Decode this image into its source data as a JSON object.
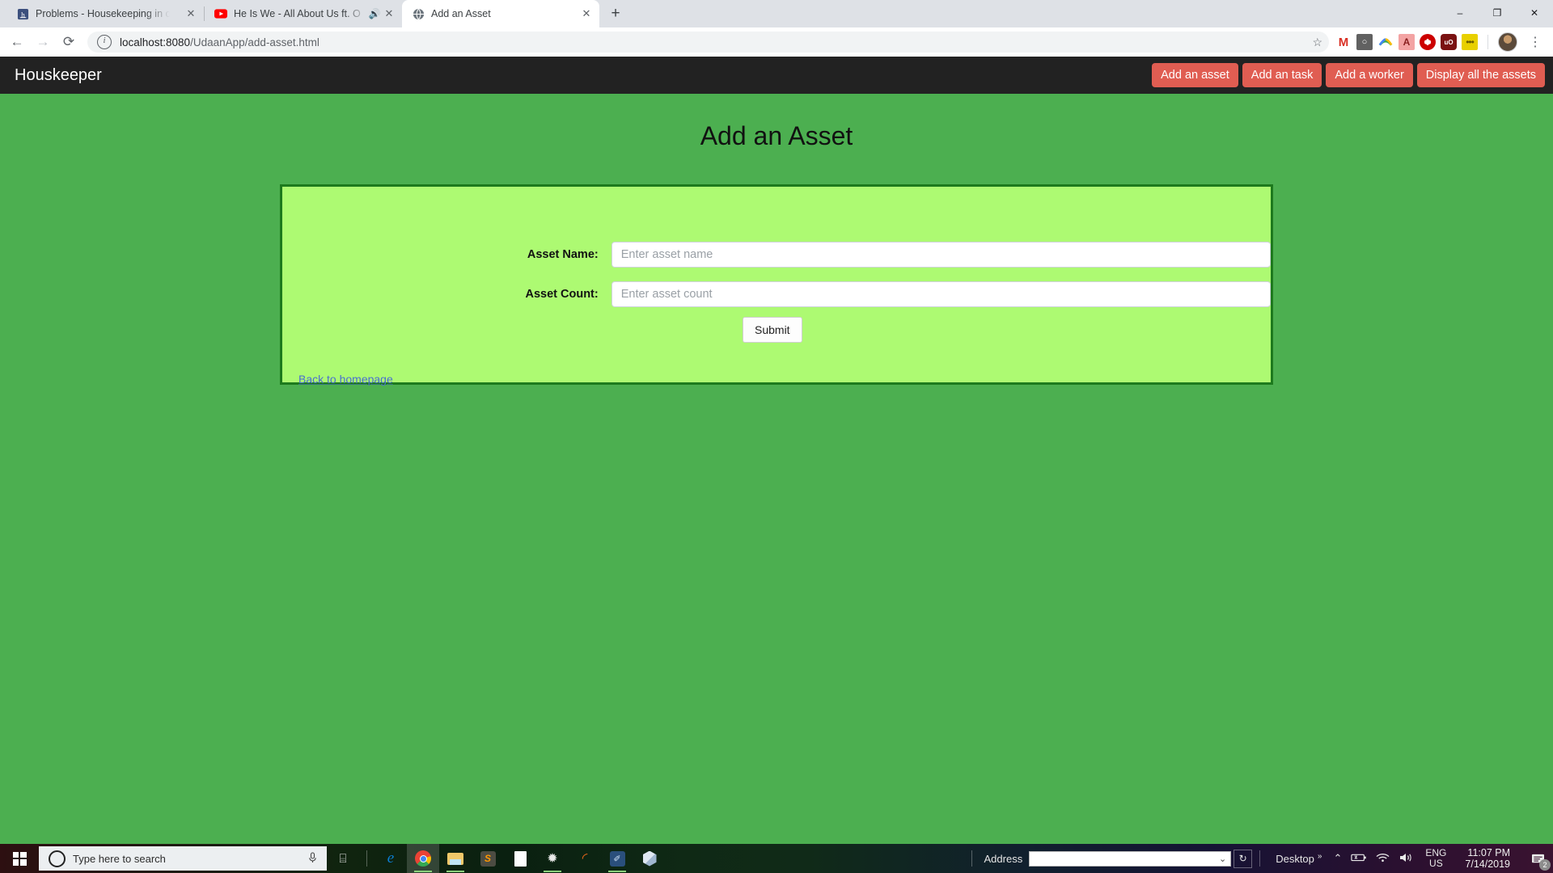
{
  "browser": {
    "tabs": [
      {
        "title": "Problems - Housekeeping in orde",
        "favicon": "hackerearth-icon",
        "audio": "",
        "close": "✕",
        "active": false
      },
      {
        "title": "He Is We - All About Us ft. O",
        "favicon": "youtube-icon",
        "audio": "🔊",
        "close": "✕",
        "active": false
      },
      {
        "title": "Add an Asset",
        "favicon": "globe-icon",
        "audio": "",
        "close": "✕",
        "active": true
      }
    ],
    "new_tab_label": "+",
    "window_controls": {
      "minimize": "–",
      "maximize": "❐",
      "close": "✕"
    },
    "nav": {
      "back": "←",
      "forward": "→",
      "reload": "⟳"
    },
    "omnibox": {
      "info_icon": "i",
      "url_host": "localhost:8080",
      "url_path": "/UdaanApp/add-asset.html",
      "star": "☆"
    },
    "extensions": [
      {
        "name": "gmail-extension-icon",
        "glyph": "M"
      },
      {
        "name": "google-keep-extension-icon",
        "glyph": "○"
      },
      {
        "name": "google-drive-extension-icon",
        "glyph": "◠"
      },
      {
        "name": "adobe-acrobat-extension-icon",
        "glyph": "A"
      },
      {
        "name": "adblock-extension-icon",
        "glyph": "✋"
      },
      {
        "name": "ublock-origin-extension-icon",
        "glyph": "uO"
      },
      {
        "name": "notes-extension-icon",
        "glyph": "•••"
      }
    ],
    "profile_avatar": "user-avatar",
    "menu": "⋮"
  },
  "page": {
    "navbar": {
      "brand": "Houskeeper",
      "actions": [
        {
          "label": "Add an asset"
        },
        {
          "label": "Add an task"
        },
        {
          "label": "Add a worker"
        },
        {
          "label": "Display all the assets"
        }
      ],
      "button_color": "#e05d52",
      "bar_color": "#222222"
    },
    "title": "Add an Asset",
    "background_color": "#4caf50",
    "panel_color": "#adfa72",
    "panel_border_color": "#1d7a1d",
    "form": {
      "fields": [
        {
          "label": "Asset Name:",
          "placeholder": "Enter asset name",
          "value": ""
        },
        {
          "label": "Asset Count:",
          "placeholder": "Enter asset count",
          "value": ""
        }
      ],
      "submit_label": "Submit",
      "back_link": "Back to homepage"
    }
  },
  "taskbar": {
    "start": "windows-logo",
    "search_placeholder": "Type here to search",
    "mic": "🎤",
    "taskview": "⌸",
    "apps": [
      {
        "name": "microsoft-edge-icon",
        "glyph": "e"
      },
      {
        "name": "google-chrome-icon",
        "glyph": ""
      },
      {
        "name": "file-explorer-icon",
        "glyph": ""
      },
      {
        "name": "sublime-text-icon",
        "glyph": "S"
      },
      {
        "name": "document-icon",
        "glyph": ""
      },
      {
        "name": "burp-suite-icon",
        "glyph": "✹"
      },
      {
        "name": "ubuntu-icon",
        "glyph": "◜"
      },
      {
        "name": "editor-tool-icon",
        "glyph": "✐"
      },
      {
        "name": "virtualbox-icon",
        "glyph": ""
      }
    ],
    "address_toolbar": {
      "label": "Address",
      "value": "",
      "dropdown": "⌄",
      "refresh": "↻"
    },
    "desktop_label": "Desktop",
    "overflow": "»",
    "tray": {
      "chevron_up": "⌃",
      "battery": "🔋",
      "wifi": "◠",
      "volume": "🔊",
      "language_line1": "ENG",
      "language_line2": "US",
      "time": "11:07 PM",
      "date": "7/14/2019",
      "notification_count": "2"
    }
  }
}
